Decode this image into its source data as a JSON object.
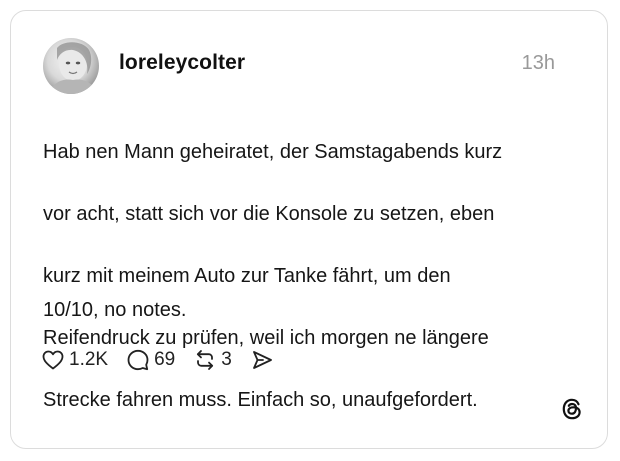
{
  "post": {
    "username": "loreleycolter",
    "timestamp": "13h",
    "body_lines": [
      "Hab nen Mann geheiratet, der Samstagabends kurz",
      "vor acht, statt sich vor die Konsole zu setzen, eben",
      "kurz mit meinem Auto zur Tanke fährt, um den",
      "Reifendruck zu prüfen, weil ich morgen ne längere",
      "Strecke fahren muss. Einfach so, unaufgefordert."
    ],
    "signoff": "10/10, no notes."
  },
  "actions": {
    "likes": "1.2K",
    "comments": "69",
    "reposts": "3"
  },
  "icons": {
    "like": "heart-icon",
    "comment": "speech-bubble-icon",
    "repost": "repost-arrows-icon",
    "share": "send-icon",
    "brand": "threads-logo-icon"
  },
  "colors": {
    "border": "#dcdcdc",
    "text": "#161616",
    "muted": "#999999"
  }
}
